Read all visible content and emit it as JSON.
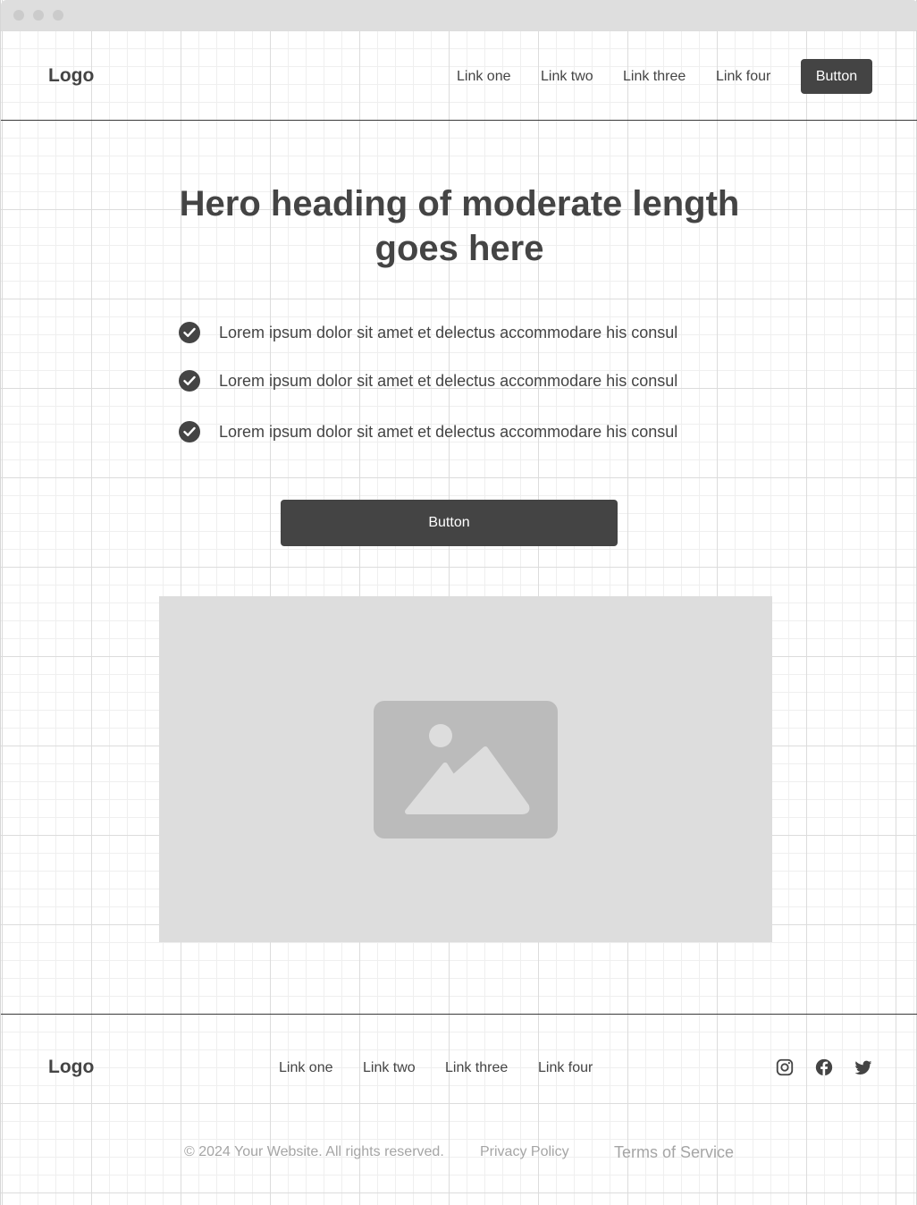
{
  "header": {
    "logo": "Logo",
    "nav": [
      "Link one",
      "Link two",
      "Link three",
      "Link four"
    ],
    "button_label": "Button"
  },
  "hero": {
    "title_line1": "Hero heading of moderate length",
    "title_line2": "goes here",
    "features": [
      "Lorem ipsum dolor sit amet et delectus accommodare his consul",
      "Lorem ipsum dolor sit amet et delectus accommodare his consul",
      "Lorem ipsum dolor sit amet et delectus accommodare his consul"
    ],
    "button_label": "Button",
    "image": "image-placeholder-icon"
  },
  "footer": {
    "logo": "Logo",
    "nav": [
      "Link one",
      "Link two",
      "Link three",
      "Link four"
    ],
    "social": [
      "instagram-icon",
      "facebook-icon",
      "twitter-icon"
    ],
    "copyright": "© 2024 Your Website. All rights reserved.",
    "privacy": "Privacy Policy",
    "terms": "Terms of Service"
  },
  "colors": {
    "primary": "#444444",
    "placeholder_bg": "#dddddd",
    "placeholder_icon": "#bbbbbb",
    "muted_text": "#a5a5a5"
  }
}
